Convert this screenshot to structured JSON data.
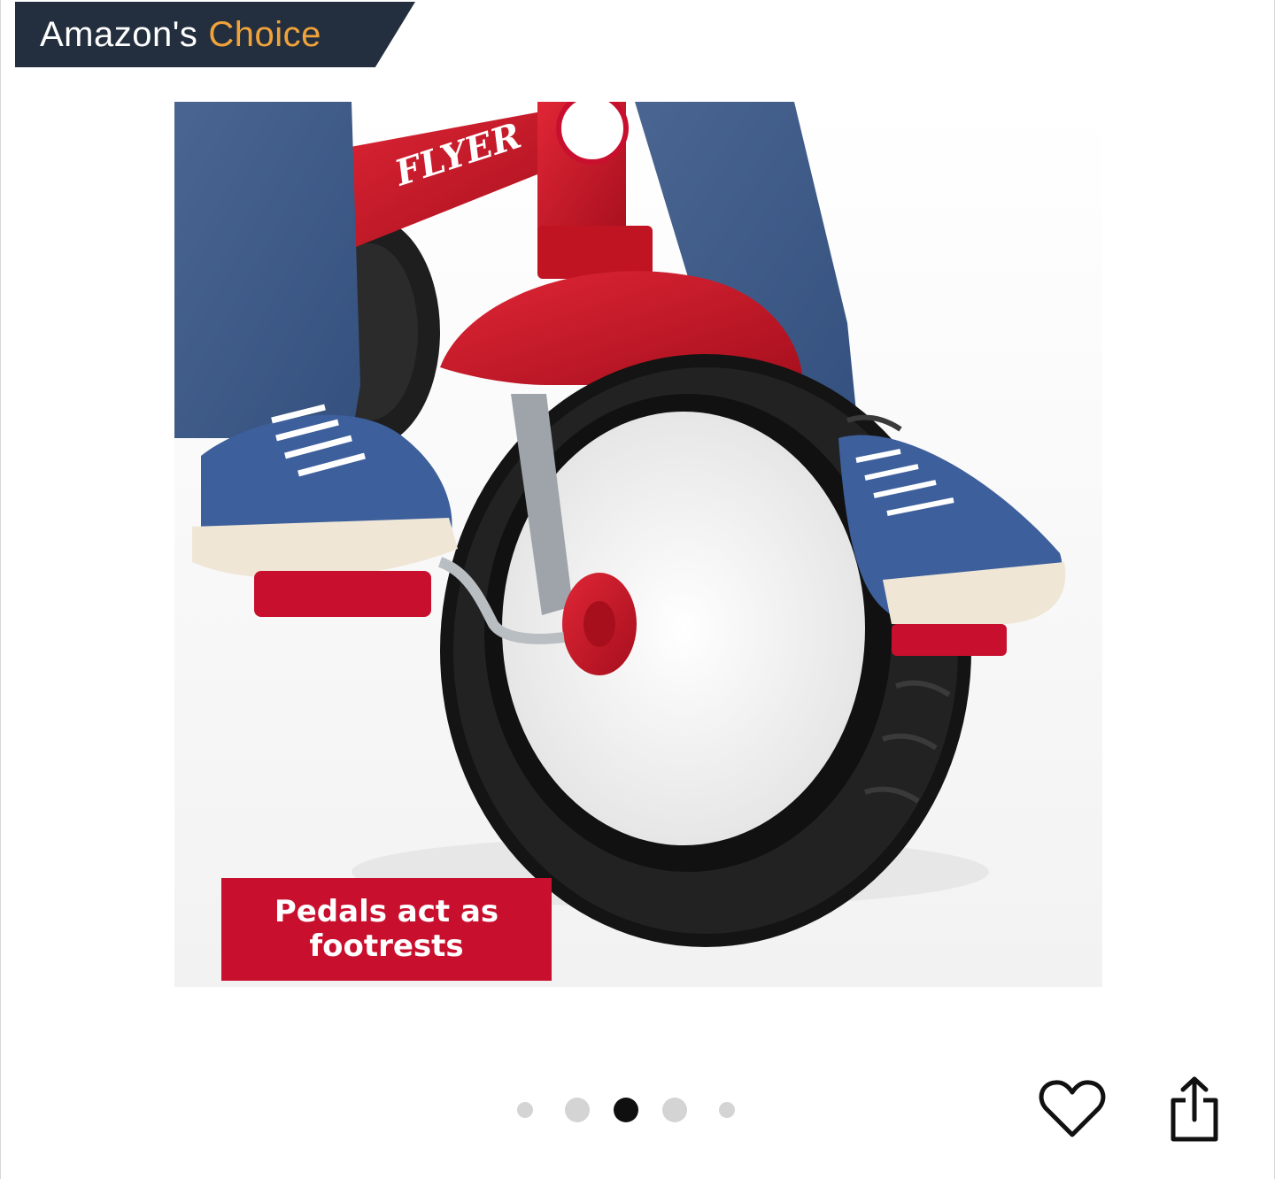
{
  "badge": {
    "word1": "Amazon's",
    "word2": "Choice",
    "bg_color": "#232f3e",
    "accent_color": "#f0a33a"
  },
  "product_image": {
    "logo_text": "FLYER",
    "caption_line1": "Pedals act as",
    "caption_line2": "footrests",
    "caption_color": "#c8102e"
  },
  "carousel": {
    "total_images": 5,
    "active_index": 2
  },
  "actions": {
    "favorite_icon": "heart-icon",
    "share_icon": "share-icon"
  }
}
